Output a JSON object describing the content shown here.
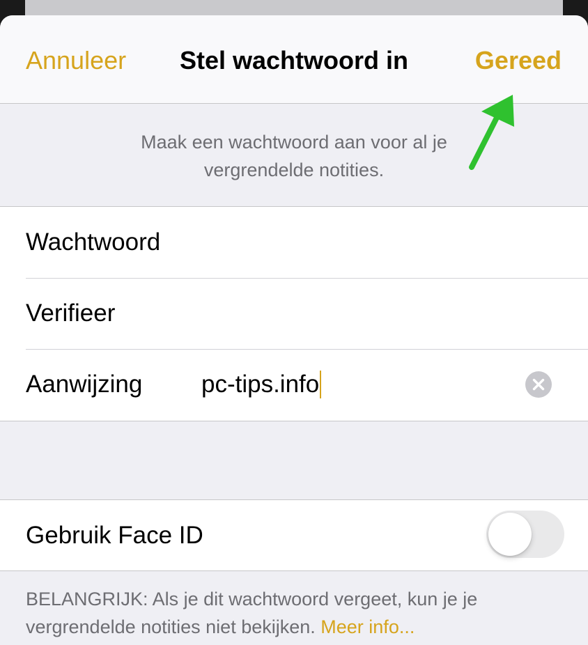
{
  "nav": {
    "cancel_label": "Annuleer",
    "title": "Stel wachtwoord in",
    "done_label": "Gereed"
  },
  "description": "Maak een wachtwoord aan voor al je vergrendelde notities.",
  "fields": [
    {
      "label": "Wachtwoord",
      "value": ""
    },
    {
      "label": "Verifieer",
      "value": ""
    },
    {
      "label": "Aanwijzing",
      "value": "pc-tips.info"
    }
  ],
  "face_id": {
    "label": "Gebruik Face ID",
    "enabled": false
  },
  "footer": {
    "text": "BELANGRIJK: Als je dit wachtwoord vergeet, kun je je vergrendelde notities niet bekijken.",
    "link": "Meer info..."
  },
  "colors": {
    "accent": "#d6a41d",
    "annotation_arrow": "#2fc12f",
    "background": "#efeff4"
  },
  "icons": {
    "clear": "clear-circle-icon",
    "annotation": "pointer-arrow-icon"
  }
}
